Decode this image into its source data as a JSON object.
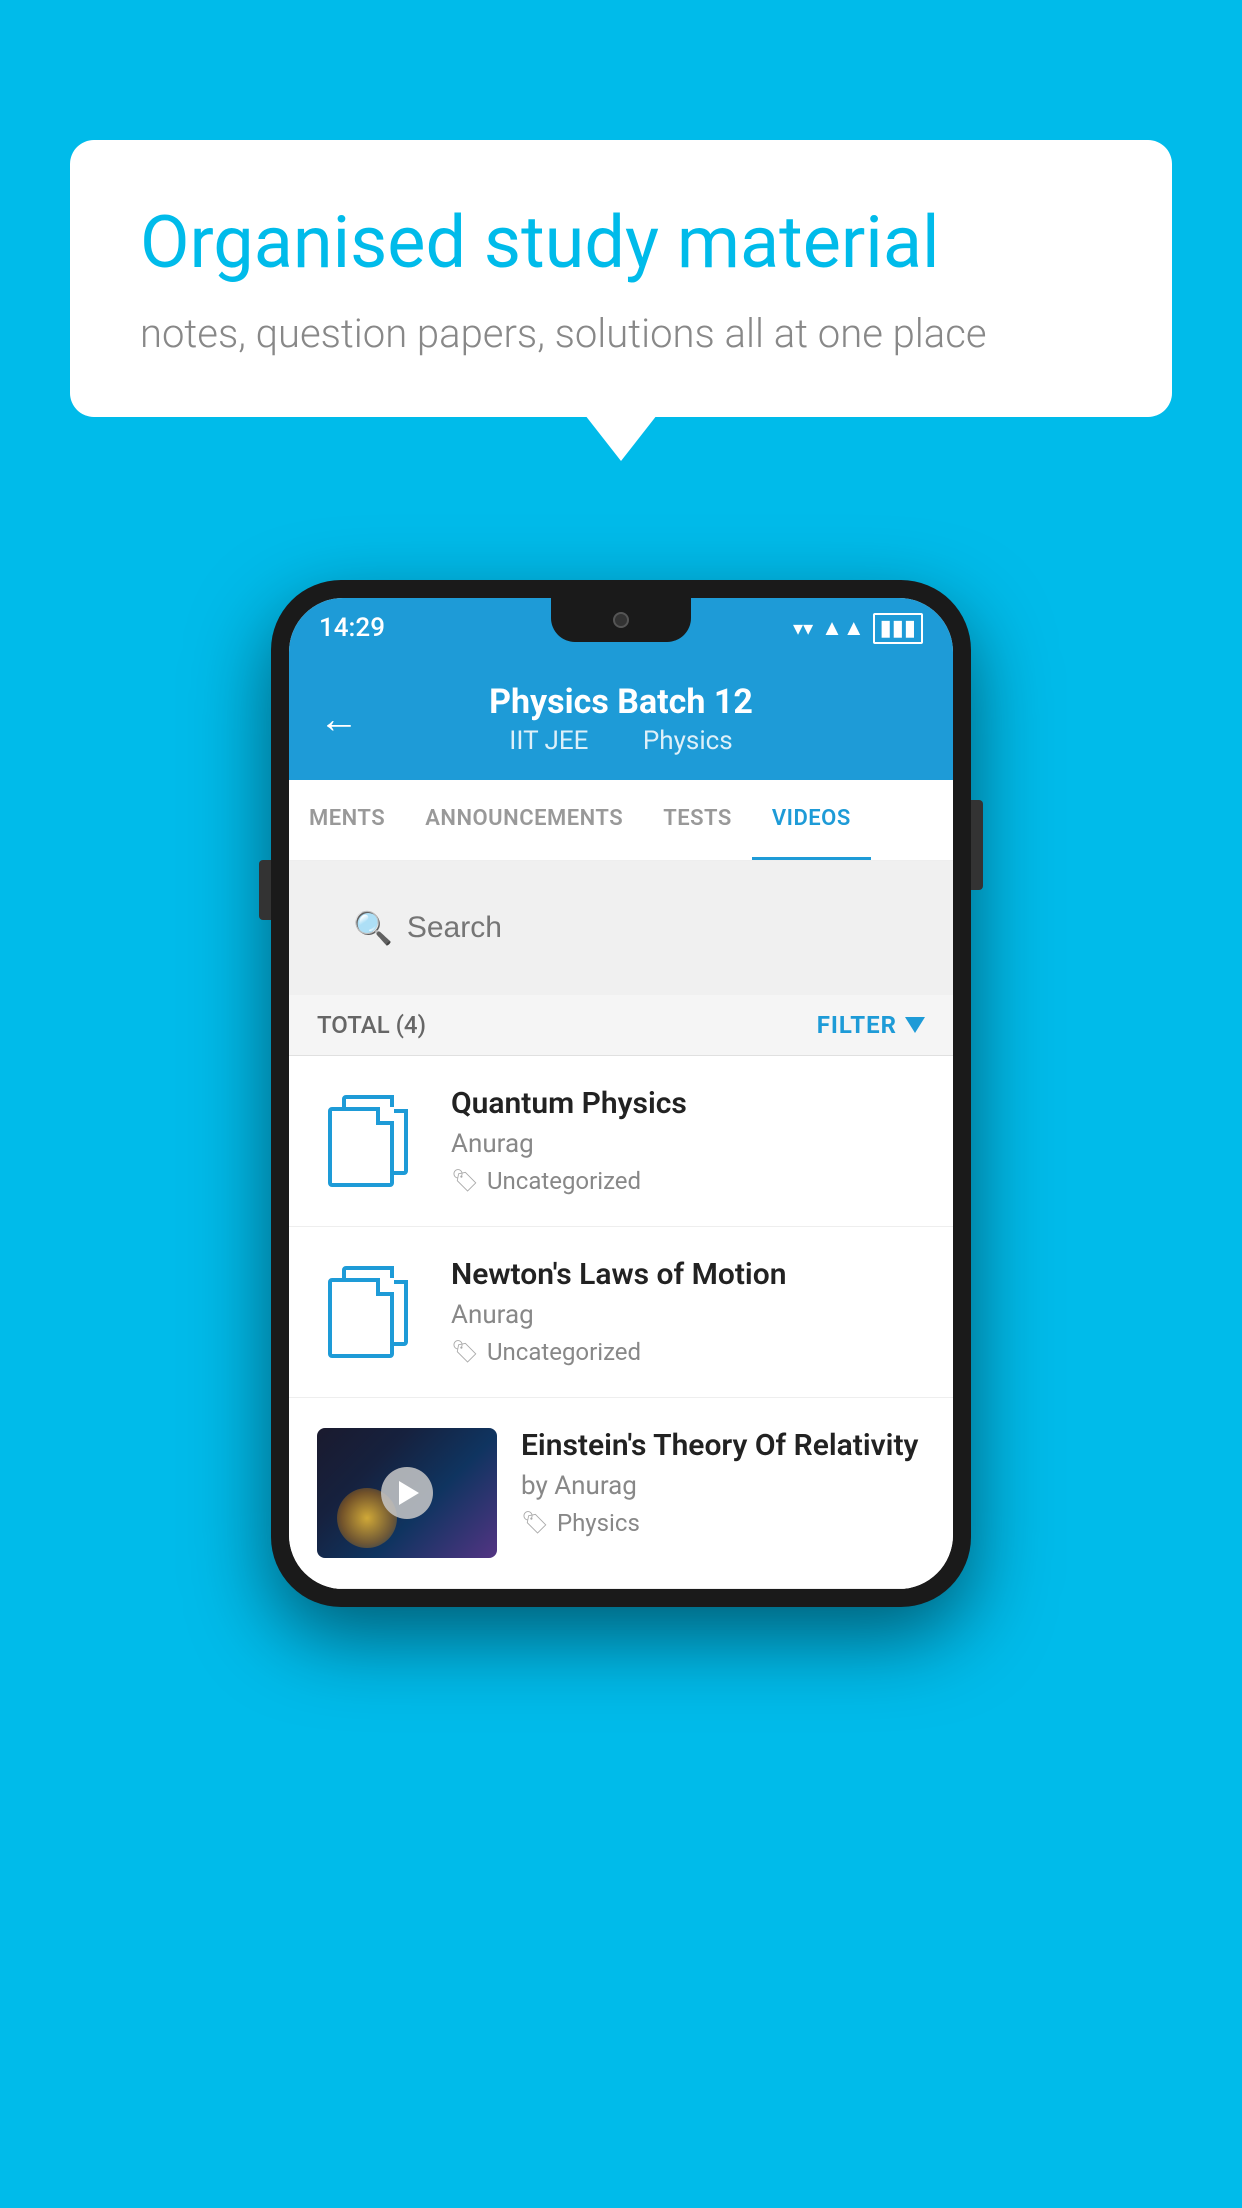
{
  "background_color": "#00BBEA",
  "speech_bubble": {
    "heading": "Organised study material",
    "subtext": "notes, question papers, solutions all at one place"
  },
  "status_bar": {
    "time": "14:29",
    "icons": [
      "wifi",
      "signal",
      "battery"
    ]
  },
  "app_header": {
    "back_label": "←",
    "title": "Physics Batch 12",
    "subtitle_part1": "IIT JEE",
    "subtitle_part2": "Physics"
  },
  "tabs": [
    {
      "label": "MENTS",
      "active": false
    },
    {
      "label": "ANNOUNCEMENTS",
      "active": false
    },
    {
      "label": "TESTS",
      "active": false
    },
    {
      "label": "VIDEOS",
      "active": true
    }
  ],
  "search": {
    "placeholder": "Search"
  },
  "filter_bar": {
    "total_label": "TOTAL (4)",
    "filter_label": "FILTER"
  },
  "video_items": [
    {
      "title": "Quantum Physics",
      "author": "Anurag",
      "tag": "Uncategorized",
      "has_thumbnail": false
    },
    {
      "title": "Newton's Laws of Motion",
      "author": "Anurag",
      "tag": "Uncategorized",
      "has_thumbnail": false
    },
    {
      "title": "Einstein's Theory Of Relativity",
      "author": "by Anurag",
      "tag": "Physics",
      "has_thumbnail": true
    }
  ]
}
